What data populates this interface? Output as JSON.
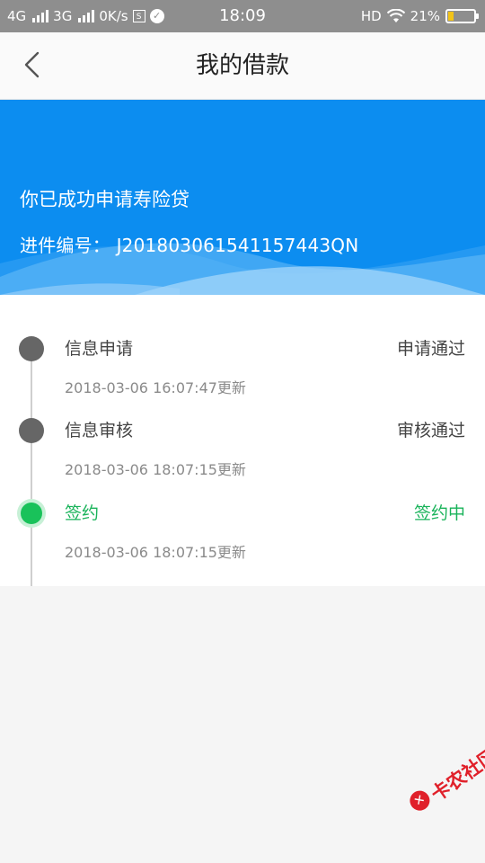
{
  "status_bar": {
    "network1": "4G",
    "network2": "3G",
    "speed": "0K/s",
    "sim_icon_text": "S",
    "time": "18:09",
    "hd": "HD",
    "battery_percent": "21%",
    "battery_level": 0.21,
    "battery_color": "#f2c318"
  },
  "nav": {
    "back_icon": "chevron-left-icon",
    "title": "我的借款"
  },
  "banner": {
    "message": "你已成功申请寿险贷",
    "ref_label": "进件编号：",
    "ref_number": "J20180306154115744 3QN",
    "bg_color": "#0c8df0"
  },
  "timeline": {
    "steps": [
      {
        "name": "信息申请",
        "status": "申请通过",
        "time": "2018-03-06 16:07:47更新",
        "active": false
      },
      {
        "name": "信息审核",
        "status": "审核通过",
        "time": "2018-03-06 18:07:15更新",
        "active": false
      },
      {
        "name": "签约",
        "status": "签约中",
        "time": "2018-03-06 18:07:15更新",
        "active": true
      }
    ],
    "active_color": "#19b35a",
    "done_color": "#666666"
  },
  "watermark": {
    "text": "卡农社区"
  }
}
